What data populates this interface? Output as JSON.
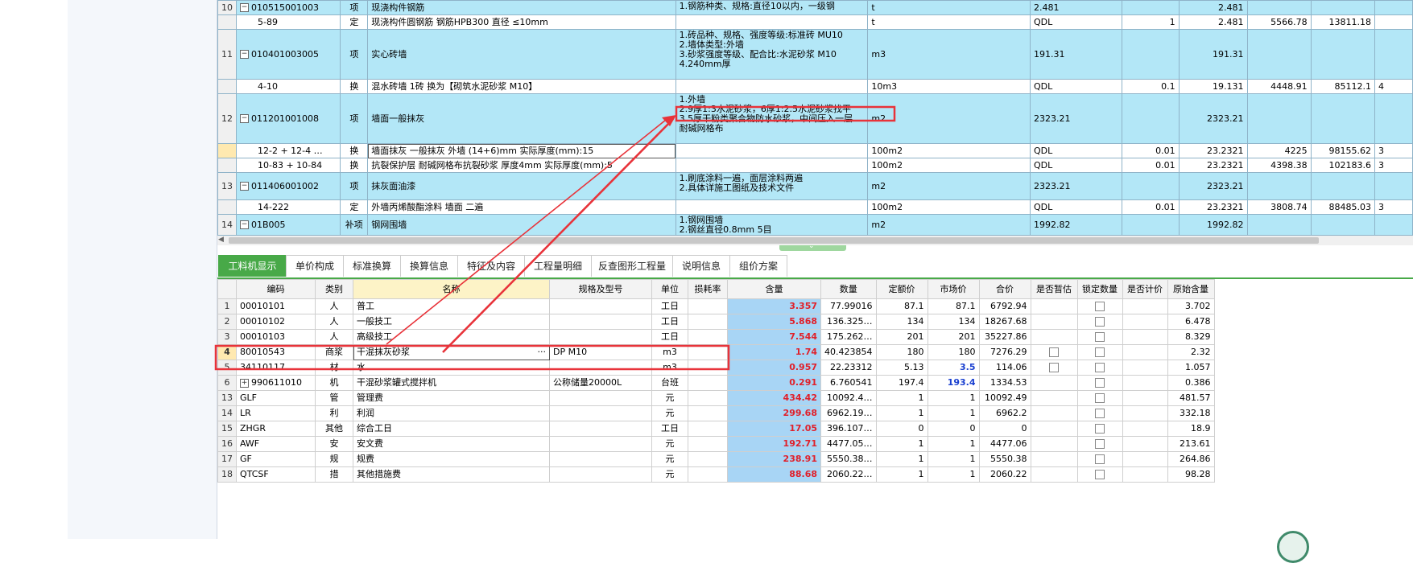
{
  "top_table": {
    "rows": [
      {
        "kind": "q",
        "num": "10",
        "code": "010515001003",
        "type": "项",
        "name": "现浇构件钢筋",
        "desc": "1.钢筋种类、规格:直径10以内，一级钢",
        "unit": "t",
        "qty": "2.481",
        "coef": "",
        "calc": "2.481",
        "price": "",
        "total": "",
        "extra": "",
        "h": 18
      },
      {
        "kind": "s",
        "num": "",
        "code": "5-89",
        "type": "定",
        "name": "现浇构件圆钢筋 钢筋HPB300 直径 ≤10mm",
        "desc": "",
        "unit": "t",
        "qty": "QDL",
        "coef": "1",
        "calc": "2.481",
        "price": "5566.78",
        "total": "13811.18",
        "extra": "",
        "h": 18
      },
      {
        "kind": "q",
        "num": "11",
        "code": "010401003005",
        "type": "项",
        "name": "实心砖墙",
        "desc": "1.砖品种、规格、强度等级:标准砖 MU10\n2.墙体类型:外墙\n3.砂浆强度等级、配合比:水泥砂浆 M10\n4.240mm厚",
        "unit": "m3",
        "qty": "191.31",
        "coef": "",
        "calc": "191.31",
        "price": "",
        "total": "",
        "extra": "",
        "h": 62
      },
      {
        "kind": "s",
        "num": "",
        "code": "4-10",
        "type": "换",
        "name": "混水砖墙 1砖  换为【砌筑水泥砂浆 M10】",
        "desc": "",
        "unit": "10m3",
        "qty": "QDL",
        "coef": "0.1",
        "calc": "19.131",
        "price": "4448.91",
        "total": "85112.1",
        "extra": "4",
        "h": 18
      },
      {
        "kind": "q",
        "num": "12",
        "code": "011201001008",
        "type": "项",
        "name": "墙面一般抹灰",
        "desc": "1.外墙\n2.9厚1:3水泥砂浆，6厚1:2.5水泥砂浆找平\n3.5厚干粉类聚合物防水砂浆，中间压入一层\n耐碱网格布",
        "unit": "m2",
        "qty": "2323.21",
        "coef": "",
        "calc": "2323.21",
        "price": "",
        "total": "",
        "extra": "",
        "h": 62
      },
      {
        "kind": "s",
        "num": "",
        "code": "12-2 + 12-4 …",
        "type": "换",
        "name": "墙面抹灰 一般抹灰 外墙 (14+6)mm  实际厚度(mm):15",
        "desc": "",
        "unit": "100m2",
        "qty": "QDL",
        "coef": "0.01",
        "calc": "23.2321",
        "price": "4225",
        "total": "98155.62",
        "extra": "3",
        "h": 18,
        "selected": true
      },
      {
        "kind": "s",
        "num": "",
        "code": "10-83 + 10-84",
        "type": "换",
        "name": "抗裂保护层 耐碱网格布抗裂砂浆 厚度4mm  实际厚度(mm):5",
        "desc": "",
        "unit": "100m2",
        "qty": "QDL",
        "coef": "0.01",
        "calc": "23.2321",
        "price": "4398.38",
        "total": "102183.6",
        "extra": "3",
        "h": 18
      },
      {
        "kind": "q",
        "num": "13",
        "code": "011406001002",
        "type": "项",
        "name": "抹灰面油漆",
        "desc": "1.刷底涂料一遍，面层涂料两遍\n2.具体详施工图纸及技术文件",
        "unit": "m2",
        "qty": "2323.21",
        "coef": "",
        "calc": "2323.21",
        "price": "",
        "total": "",
        "extra": "",
        "h": 34
      },
      {
        "kind": "s",
        "num": "",
        "code": "14-222",
        "type": "定",
        "name": "外墙丙烯酸酯涂料 墙面 二遍",
        "desc": "",
        "unit": "100m2",
        "qty": "QDL",
        "coef": "0.01",
        "calc": "23.2321",
        "price": "3808.74",
        "total": "88485.03",
        "extra": "3",
        "h": 18
      },
      {
        "kind": "q",
        "num": "14",
        "code": "01B005",
        "type": "补项",
        "name": "钢网围墙",
        "desc": "1.钢网围墙\n2.钢丝直径0.8mm 5目",
        "unit": "m2",
        "qty": "1992.82",
        "coef": "",
        "calc": "1992.82",
        "price": "",
        "total": "",
        "extra": "",
        "h": 26
      }
    ]
  },
  "tabs": [
    {
      "label": "工料机显示",
      "active": true
    },
    {
      "label": "单价构成"
    },
    {
      "label": "标准换算"
    },
    {
      "label": "换算信息"
    },
    {
      "label": "特征及内容"
    },
    {
      "label": "工程量明细"
    },
    {
      "label": "反查图形工程量"
    },
    {
      "label": "说明信息"
    },
    {
      "label": "组价方案"
    }
  ],
  "bottom_table": {
    "headers": [
      "编码",
      "类别",
      "名称",
      "规格及型号",
      "单位",
      "损耗率",
      "含量",
      "数量",
      "定额价",
      "市场价",
      "合价",
      "是否暂估",
      "锁定数量",
      "是否计价",
      "原始含量"
    ],
    "rows": [
      {
        "num": "1",
        "code": "00010101",
        "cat": "人",
        "name": "普工",
        "spec": "",
        "unit": "工日",
        "loss": "",
        "content": "3.357",
        "qty": "77.99016",
        "base": "87.1",
        "market": "87.1",
        "market_blue": false,
        "total": "6792.94",
        "est": false,
        "lock": true,
        "orig": "3.702"
      },
      {
        "num": "2",
        "code": "00010102",
        "cat": "人",
        "name": "一般技工",
        "spec": "",
        "unit": "工日",
        "loss": "",
        "content": "5.868",
        "qty": "136.325…",
        "base": "134",
        "market": "134",
        "market_blue": false,
        "total": "18267.68",
        "est": false,
        "lock": true,
        "orig": "6.478"
      },
      {
        "num": "3",
        "code": "00010103",
        "cat": "人",
        "name": "高级技工",
        "spec": "",
        "unit": "工日",
        "loss": "",
        "content": "7.544",
        "qty": "175.262…",
        "base": "201",
        "market": "201",
        "market_blue": false,
        "total": "35227.86",
        "est": false,
        "lock": true,
        "orig": "8.329"
      },
      {
        "num": "4",
        "code": "80010543",
        "cat": "商浆",
        "name": "干混抹灰砂浆",
        "spec": "DP M10",
        "unit": "m3",
        "loss": "",
        "content": "1.74",
        "qty": "40.423854",
        "base": "180",
        "market": "180",
        "market_blue": false,
        "total": "7276.29",
        "est": true,
        "lock": true,
        "orig": "2.32",
        "selected": true
      },
      {
        "num": "5",
        "code": "34110117",
        "cat": "材",
        "name": "水",
        "spec": "",
        "unit": "m3",
        "loss": "",
        "content": "0.957",
        "qty": "22.23312",
        "base": "5.13",
        "market": "3.5",
        "market_blue": true,
        "total": "114.06",
        "est": true,
        "lock": true,
        "orig": "1.057"
      },
      {
        "num": "6",
        "code": "990611010",
        "cat": "机",
        "name": "干混砂浆罐式搅拌机",
        "spec": "公称储量20000L",
        "unit": "台班",
        "loss": "",
        "content": "0.291",
        "qty": "6.760541",
        "base": "197.4",
        "market": "193.4",
        "market_blue": true,
        "total": "1334.53",
        "est": false,
        "lock": true,
        "orig": "0.386",
        "expand": true
      },
      {
        "num": "13",
        "code": "GLF",
        "cat": "管",
        "name": "管理费",
        "spec": "",
        "unit": "元",
        "loss": "",
        "content": "434.42",
        "qty": "10092.4…",
        "base": "1",
        "market": "1",
        "market_blue": false,
        "total": "10092.49",
        "est": false,
        "lock": true,
        "orig": "481.57"
      },
      {
        "num": "14",
        "code": "LR",
        "cat": "利",
        "name": "利润",
        "spec": "",
        "unit": "元",
        "loss": "",
        "content": "299.68",
        "qty": "6962.19…",
        "base": "1",
        "market": "1",
        "market_blue": false,
        "total": "6962.2",
        "est": false,
        "lock": true,
        "orig": "332.18"
      },
      {
        "num": "15",
        "code": "ZHGR",
        "cat": "其他",
        "name": "综合工日",
        "spec": "",
        "unit": "工日",
        "loss": "",
        "content": "17.05",
        "qty": "396.107…",
        "base": "0",
        "market": "0",
        "market_blue": false,
        "total": "0",
        "est": false,
        "lock": true,
        "orig": "18.9"
      },
      {
        "num": "16",
        "code": "AWF",
        "cat": "安",
        "name": "安文费",
        "spec": "",
        "unit": "元",
        "loss": "",
        "content": "192.71",
        "qty": "4477.05…",
        "base": "1",
        "market": "1",
        "market_blue": false,
        "total": "4477.06",
        "est": false,
        "lock": true,
        "orig": "213.61"
      },
      {
        "num": "17",
        "code": "GF",
        "cat": "规",
        "name": "规费",
        "spec": "",
        "unit": "元",
        "loss": "",
        "content": "238.91",
        "qty": "5550.38…",
        "base": "1",
        "market": "1",
        "market_blue": false,
        "total": "5550.38",
        "est": false,
        "lock": true,
        "orig": "264.86"
      },
      {
        "num": "18",
        "code": "QTCSF",
        "cat": "措",
        "name": "其他措施费",
        "spec": "",
        "unit": "元",
        "loss": "",
        "content": "88.68",
        "qty": "2060.22…",
        "base": "1",
        "market": "1",
        "market_blue": false,
        "total": "2060.22",
        "est": false,
        "lock": true,
        "orig": "98.28"
      }
    ]
  },
  "colors": {
    "accent": "#48a948",
    "row_blue": "#b3e7f7",
    "content_blue": "#a8d5f5",
    "annotation_red": "#e8333a"
  }
}
